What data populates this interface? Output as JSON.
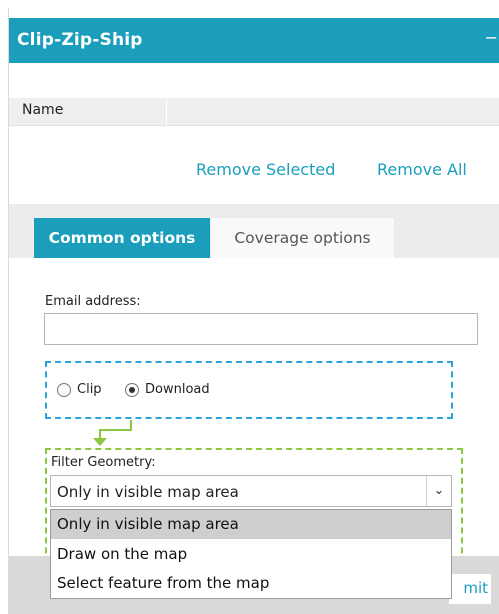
{
  "panel": {
    "title": "Clip-Zip-Ship",
    "collapse_glyph": "−",
    "collapse_icon": "minus-icon",
    "accent_color": "#1a9ebc"
  },
  "table": {
    "columns": [
      "Name"
    ]
  },
  "actions": {
    "remove_selected": "Remove Selected",
    "remove_all": "Remove All"
  },
  "tabs": [
    {
      "label": "Common options",
      "active": true
    },
    {
      "label": "Coverage options",
      "active": false
    }
  ],
  "form": {
    "email_label": "Email address:",
    "email_value": "",
    "mode": {
      "options": [
        "Clip",
        "Download"
      ],
      "selected": "Download"
    },
    "filter_label": "Filter Geometry:",
    "filter_selected": "Only in visible map area",
    "filter_options": [
      "Only in visible map area",
      "Draw on the map",
      "Select feature from the map"
    ],
    "chevron_glyph": "⌄",
    "chevron_icon": "chevron-down-icon"
  },
  "footer": {
    "submit_partial": "mit"
  }
}
